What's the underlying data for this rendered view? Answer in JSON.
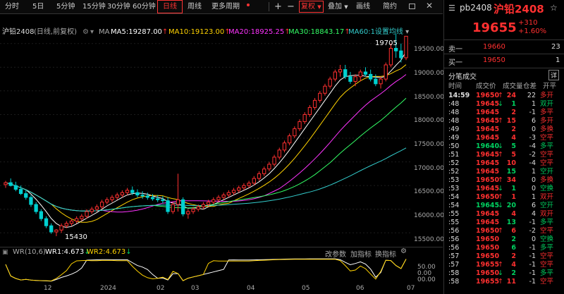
{
  "toolbar": {
    "periods": [
      "分时",
      "5日",
      "5分钟",
      "15分钟",
      "30分钟",
      "60分钟",
      "日线",
      "周线",
      "更多周期"
    ],
    "active_period": "日线",
    "plus": "+",
    "minus": "−",
    "fuquan": "复权",
    "tools": [
      "叠加",
      "画线",
      "简约"
    ]
  },
  "chart_header": {
    "symbol": "沪铅2408",
    "mode": "(日线,前复权)",
    "ma_label": "MA",
    "ma5": "MA5:19287.00",
    "ma10": "MA10:19123.00",
    "ma20": "MA20:18925.25",
    "ma30": "MA30:18843.17",
    "ma60": "MA60:1设置均线",
    "colors": {
      "ma5": "#ffffff",
      "ma10": "#ffd200",
      "ma20": "#ff33ff",
      "ma30": "#33ff66",
      "ma60": "#33cccc"
    }
  },
  "price_axis": [
    "19500.00",
    "19000.00",
    "18500.00",
    "18000.00",
    "17500.00",
    "17000.00",
    "16500.00",
    "16000.00",
    "15500.00"
  ],
  "annotations": {
    "high": "19705",
    "low": "15430"
  },
  "time_axis": [
    "12",
    "2024",
    "02",
    "03",
    "04",
    "05",
    "06",
    "07"
  ],
  "indicator": {
    "name": "WR(10,6)",
    "wr1": "WR1:4.673",
    "wr2": "WR2:4.673",
    "buttons": [
      "改参数",
      "加指标",
      "换指标"
    ],
    "axis": [
      "50.00",
      "0.00",
      "00.00"
    ]
  },
  "chart_data": {
    "type": "candlestick",
    "y_range": [
      15400,
      19750
    ],
    "candles": [
      [
        16520,
        16600,
        16450,
        16560
      ],
      [
        16560,
        16650,
        16480,
        16500
      ],
      [
        16500,
        16580,
        16380,
        16420
      ],
      [
        16420,
        16500,
        16300,
        16330
      ],
      [
        16330,
        16400,
        16200,
        16250
      ],
      [
        16250,
        16300,
        16050,
        16100
      ],
      [
        16100,
        16150,
        15900,
        15950
      ],
      [
        15950,
        16000,
        15750,
        15800
      ],
      [
        15800,
        15850,
        15600,
        15650
      ],
      [
        15650,
        15700,
        15480,
        15520
      ],
      [
        15520,
        15580,
        15430,
        15560
      ],
      [
        15560,
        15700,
        15500,
        15650
      ],
      [
        15650,
        15750,
        15600,
        15700
      ],
      [
        15700,
        15800,
        15650,
        15750
      ],
      [
        15750,
        15850,
        15700,
        15800
      ],
      [
        15800,
        15900,
        15750,
        15850
      ],
      [
        15850,
        16000,
        15800,
        15950
      ],
      [
        15950,
        16050,
        15900,
        16000
      ],
      [
        16000,
        16100,
        15950,
        16050
      ],
      [
        16050,
        16200,
        16000,
        16150
      ],
      [
        16150,
        16250,
        16100,
        16200
      ],
      [
        16200,
        16300,
        16150,
        16250
      ],
      [
        16250,
        16350,
        16200,
        16300
      ],
      [
        16300,
        16400,
        16250,
        16350
      ],
      [
        16350,
        16450,
        16300,
        16400
      ],
      [
        16400,
        16480,
        16300,
        16350
      ],
      [
        16350,
        16420,
        16250,
        16300
      ],
      [
        16300,
        16380,
        16220,
        16280
      ],
      [
        16280,
        16350,
        16200,
        16250
      ],
      [
        16250,
        16320,
        16180,
        16220
      ],
      [
        16220,
        16300,
        16150,
        16200
      ],
      [
        16200,
        16280,
        16120,
        16180
      ],
      [
        16180,
        16250,
        15900,
        15950
      ],
      [
        15950,
        16150,
        15900,
        16100
      ],
      [
        16100,
        16750,
        15950,
        16200
      ],
      [
        16200,
        16250,
        15850,
        15900
      ],
      [
        15900,
        16000,
        15800,
        15950
      ],
      [
        15950,
        16050,
        15900,
        16000
      ],
      [
        16000,
        16100,
        15950,
        16050
      ],
      [
        16050,
        16150,
        16000,
        16100
      ],
      [
        16100,
        16200,
        16050,
        16150
      ],
      [
        16150,
        16250,
        16100,
        16200
      ],
      [
        16200,
        16300,
        16150,
        16250
      ],
      [
        16250,
        16350,
        16200,
        16300
      ],
      [
        16300,
        16400,
        16250,
        16350
      ],
      [
        16350,
        16450,
        16300,
        16400
      ],
      [
        16400,
        16500,
        16350,
        16450
      ],
      [
        16450,
        16550,
        16400,
        16500
      ],
      [
        16500,
        16600,
        16450,
        16550
      ],
      [
        16550,
        16700,
        16500,
        16650
      ],
      [
        16650,
        16800,
        16600,
        16750
      ],
      [
        16750,
        16900,
        16700,
        16850
      ],
      [
        16850,
        17000,
        16800,
        16950
      ],
      [
        16950,
        17150,
        16900,
        17100
      ],
      [
        17100,
        17300,
        17050,
        17250
      ],
      [
        17250,
        17450,
        17200,
        17400
      ],
      [
        17400,
        17600,
        17350,
        17550
      ],
      [
        17550,
        17750,
        17500,
        17700
      ],
      [
        17700,
        17900,
        17650,
        17850
      ],
      [
        17850,
        18050,
        17800,
        18000
      ],
      [
        18000,
        18200,
        17950,
        18150
      ],
      [
        18150,
        18350,
        18100,
        18300
      ],
      [
        18300,
        18500,
        18250,
        18450
      ],
      [
        18450,
        18650,
        18400,
        18600
      ],
      [
        18600,
        18800,
        18550,
        18750
      ],
      [
        18750,
        18950,
        18700,
        18900
      ],
      [
        18900,
        19050,
        18800,
        18950
      ],
      [
        18950,
        19050,
        18750,
        18800
      ],
      [
        18800,
        18900,
        18650,
        18700
      ],
      [
        18700,
        18850,
        18600,
        18800
      ],
      [
        18800,
        18950,
        18700,
        18900
      ],
      [
        18900,
        19000,
        18800,
        18850
      ],
      [
        18850,
        18950,
        18700,
        18750
      ],
      [
        18750,
        18850,
        18600,
        18650
      ],
      [
        18650,
        18800,
        18550,
        18750
      ],
      [
        18750,
        19100,
        18700,
        19050
      ],
      [
        19050,
        19500,
        19000,
        19400
      ],
      [
        19400,
        19705,
        19200,
        19345
      ],
      [
        19345,
        19500,
        19100,
        19200
      ],
      [
        19200,
        19655,
        19150,
        19655
      ]
    ]
  },
  "quote": {
    "code": "pb2408",
    "name": "沪铅2408",
    "price": "19655",
    "change": "+310",
    "change_pct": "+1.60%",
    "sell1_label": "卖一",
    "sell1_price": "19660",
    "sell1_vol": "23",
    "buy1_label": "买一",
    "buy1_price": "19650",
    "buy1_vol": "1"
  },
  "ticks": {
    "title": "分笔成交",
    "detail": "详",
    "headers": [
      "时间",
      "成交价",
      "成交量",
      "仓差",
      "开平"
    ],
    "rows": [
      [
        "14:59",
        "19650",
        "↑",
        "24",
        "22",
        "多开",
        "red",
        "red"
      ],
      [
        ":48",
        "19645",
        "↓",
        "1",
        "1",
        "双开",
        "red",
        "green"
      ],
      [
        ":48",
        "19645",
        "",
        "2",
        "-1",
        "多平",
        "red",
        "red"
      ],
      [
        ":48",
        "19645",
        "↑",
        "15",
        "6",
        "多开",
        "red",
        "red"
      ],
      [
        ":49",
        "19645",
        "",
        "2",
        "0",
        "多换",
        "red",
        "red"
      ],
      [
        ":49",
        "19645",
        "",
        "4",
        "-3",
        "空平",
        "red",
        "red"
      ],
      [
        ":50",
        "19640",
        "↓",
        "5",
        "-4",
        "多平",
        "green",
        "green"
      ],
      [
        ":51",
        "19645",
        "↑",
        "5",
        "-2",
        "空平",
        "red",
        "red"
      ],
      [
        ":52",
        "19645",
        "",
        "10",
        "-4",
        "空平",
        "red",
        "red"
      ],
      [
        ":52",
        "19645",
        "",
        "15",
        "1",
        "空开",
        "red",
        "green"
      ],
      [
        ":53",
        "19650",
        "↑",
        "34",
        "0",
        "多换",
        "red",
        "red"
      ],
      [
        ":53",
        "19645",
        "↓",
        "1",
        "0",
        "空换",
        "red",
        "green"
      ],
      [
        ":54",
        "19650",
        "↑",
        "1",
        "1",
        "双开",
        "red",
        "red"
      ],
      [
        ":54",
        "19645",
        "↓",
        "20",
        "6",
        "空开",
        "green",
        "green"
      ],
      [
        ":55",
        "19645",
        "",
        "4",
        "4",
        "双开",
        "red",
        "red"
      ],
      [
        ":55",
        "19645",
        "",
        "13",
        "-1",
        "多平",
        "red",
        "green"
      ],
      [
        ":56",
        "19650",
        "↑",
        "6",
        "-2",
        "空平",
        "red",
        "red"
      ],
      [
        ":56",
        "19650",
        "",
        "2",
        "0",
        "空换",
        "red",
        "green"
      ],
      [
        ":56",
        "19650",
        "",
        "6",
        "-1",
        "多平",
        "red",
        "green"
      ],
      [
        ":57",
        "19650",
        "",
        "2",
        "-1",
        "空平",
        "red",
        "red"
      ],
      [
        ":57",
        "19655",
        "↑",
        "4",
        "-1",
        "空平",
        "red",
        "red"
      ],
      [
        ":58",
        "19650",
        "↓",
        "2",
        "-1",
        "多平",
        "red",
        "green"
      ],
      [
        ":58",
        "19655",
        "↑",
        "11",
        "-1",
        "空平",
        "red",
        "red"
      ]
    ]
  }
}
